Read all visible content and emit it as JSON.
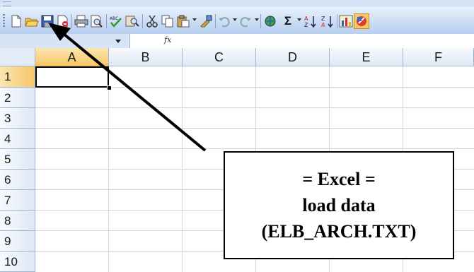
{
  "toolbar": {
    "icons": [
      "new-icon",
      "open-icon",
      "save-icon",
      "permission-icon",
      "print-icon",
      "print-preview-icon",
      "spelling-icon",
      "research-icon",
      "cut-icon",
      "copy-icon",
      "paste-icon",
      "format-painter-icon",
      "undo-icon",
      "redo-icon",
      "hyperlink-icon",
      "autosum-icon",
      "sort-ascending-icon",
      "sort-descending-icon",
      "chart-wizard-icon",
      "drawing-icon"
    ],
    "autosum_label": "Σ",
    "fx_label": "fx"
  },
  "grid": {
    "columns": [
      "A",
      "B",
      "C",
      "D",
      "E",
      "F"
    ],
    "rows": [
      "1",
      "2",
      "3",
      "4",
      "5",
      "6",
      "7",
      "8",
      "9",
      "10"
    ],
    "selected_cell": "A1"
  },
  "callout": {
    "line1": "= Excel =",
    "line2": "load data",
    "line3": "(ELB_ARCH.TXT)"
  },
  "colors": {
    "toolbar_bg": "#c9dbf3",
    "header_selected": "#f6c768",
    "gridline": "#d4d4d4"
  }
}
